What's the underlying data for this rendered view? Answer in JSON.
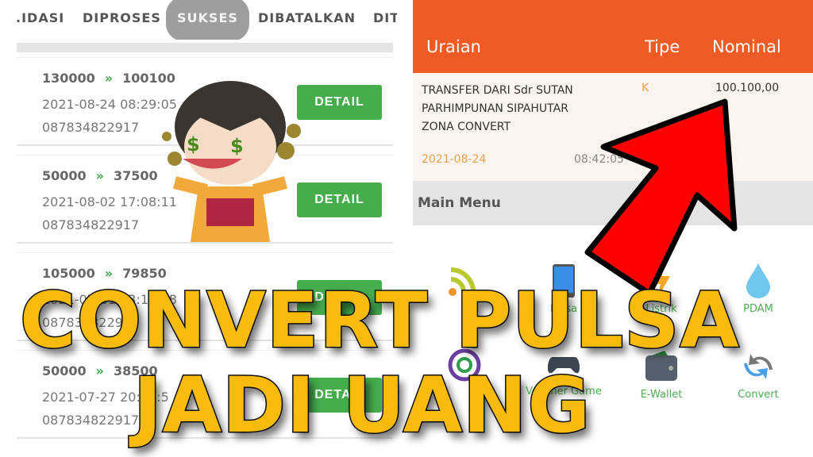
{
  "tabs": [
    {
      "label": ".IDASI"
    },
    {
      "label": "DIPROSES"
    },
    {
      "label": "SUKSES",
      "active": true
    },
    {
      "label": "DIBATALKAN"
    },
    {
      "label": "DIT"
    }
  ],
  "transactions": [
    {
      "from": "130000",
      "to": "100100",
      "datetime": "2021-08-24 08:29:05",
      "phone": "087834822917",
      "button": "DETAIL"
    },
    {
      "from": "50000",
      "to": "37500",
      "datetime": "2021-08-02 17:08:11",
      "phone": "087834822917",
      "button": "DETAIL"
    },
    {
      "from": "105000",
      "to": "79850",
      "datetime": "2021-07-31 13:15:48",
      "phone": "087834822917",
      "button": "DETAIL"
    },
    {
      "from": "50000",
      "to": "38500",
      "datetime": "2021-07-27 20:02:5",
      "phone": "087834822917",
      "button": "DETAIL"
    }
  ],
  "arrow_glyph": "»",
  "mutation": {
    "headers": {
      "desc": "Uraian",
      "type": "Tipe",
      "amount": "Nominal"
    },
    "row": {
      "desc1": "TRANSFER DARI Sdr SUTAN",
      "desc2": "PARHIMPUNAN SIPAHUTAR",
      "desc3": "ZONA CONVERT",
      "type": "K",
      "amount": "100.100,00",
      "date": "2021-08-24",
      "time": "08:42:05"
    }
  },
  "main_menu": {
    "title": "Main Menu",
    "items": [
      {
        "label": "",
        "icon": "wifi-signal-icon"
      },
      {
        "label": "Pulsa",
        "icon": "phone-icon"
      },
      {
        "label": "Listrik",
        "icon": "lightning-icon"
      },
      {
        "label": "PDAM",
        "icon": "water-drop-icon"
      },
      {
        "label": "",
        "icon": "community-icon"
      },
      {
        "label": "Voucher Game",
        "icon": "gamepad-icon"
      },
      {
        "label": "E-Wallet",
        "icon": "wallet-icon"
      },
      {
        "label": "Convert",
        "icon": "convert-arrows-icon"
      }
    ]
  },
  "overlay": {
    "line1": "CONVERT PULSA",
    "line2": "JADI UANG"
  },
  "colors": {
    "accent": "#f05a24",
    "success": "#45ad4c",
    "title": "#f8bb0b",
    "arrow": "#ff0000"
  }
}
